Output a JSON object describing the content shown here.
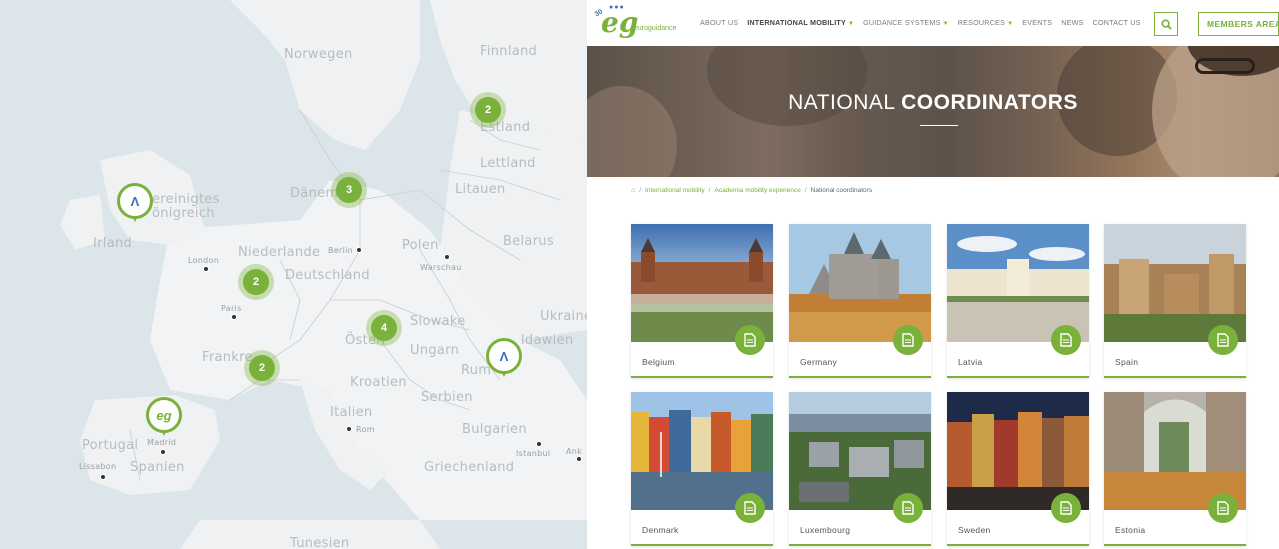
{
  "map": {
    "labels": {
      "norwegen": "Norwegen",
      "finnland": "Finnland",
      "estland": "Estland",
      "lettland": "Lettland",
      "daenemark": "Dänem",
      "litauen": "Litauen",
      "vereinigtes": "ereinigtes",
      "koenigreich": "önigreich",
      "irland": "Irland",
      "niederlande": "Niederlande",
      "polen": "Polen",
      "belarus": "Belarus",
      "deutschland": "Deutschland",
      "ukraine": "Ukraine",
      "slowakei": "Slowake",
      "moldawien": "ldawien",
      "frankreich": "Frankre",
      "oesterreich": "Österr",
      "ungarn": "Ungarn",
      "rumaenien": "Rum",
      "kroatien": "Kroatien",
      "serbien": "Serbien",
      "italien": "Italien",
      "bulgarien": "Bulgarien",
      "portugal": "Portugal",
      "spanien": "Spanien",
      "griechenland": "Griechenland",
      "tunesien": "Tunesien",
      "london": "London",
      "paris": "Paris",
      "berlin": "Berlin",
      "warschau": "Warschau",
      "rom": "Rom",
      "madrid": "Madrid",
      "lissabon": "Lissabon",
      "istanbul": "Istanbul",
      "ank": "Ank"
    },
    "clusters": [
      {
        "count": "2"
      },
      {
        "count": "3"
      },
      {
        "count": "2"
      },
      {
        "count": "4"
      },
      {
        "count": "2"
      }
    ]
  },
  "site": {
    "logo": {
      "number": "30",
      "text": "euroguidance",
      "mark": "eg"
    },
    "menu": [
      {
        "label": "ABOUT US",
        "dropdown": false
      },
      {
        "label": "INTERNATIONAL MOBILITY",
        "dropdown": true,
        "active": true
      },
      {
        "label": "GUIDANCE SYSTEMS",
        "dropdown": true
      },
      {
        "label": "RESOURCES",
        "dropdown": true
      },
      {
        "label": "EVENTS",
        "dropdown": false
      },
      {
        "label": "NEWS",
        "dropdown": false
      },
      {
        "label": "CONTACT US",
        "dropdown": false
      }
    ],
    "members_button": "MEMBERS AREA",
    "hero": {
      "title_light": "NATIONAL ",
      "title_bold": "COORDINATORS"
    },
    "breadcrumb": {
      "items": [
        "International mobility",
        "Academia mobility experience"
      ],
      "current": "National coordinators",
      "separator": "/"
    },
    "countries": [
      "Belgium",
      "Germany",
      "Latvia",
      "Spain",
      "Denmark",
      "Luxembourg",
      "Sweden",
      "Estonia"
    ]
  },
  "colors": {
    "accent": "#7ab13a",
    "logo_blue": "#3b6fb8"
  },
  "icons": {
    "search": "search-icon",
    "document": "document-icon",
    "home": "home-icon",
    "caret": "caret-down-icon"
  }
}
